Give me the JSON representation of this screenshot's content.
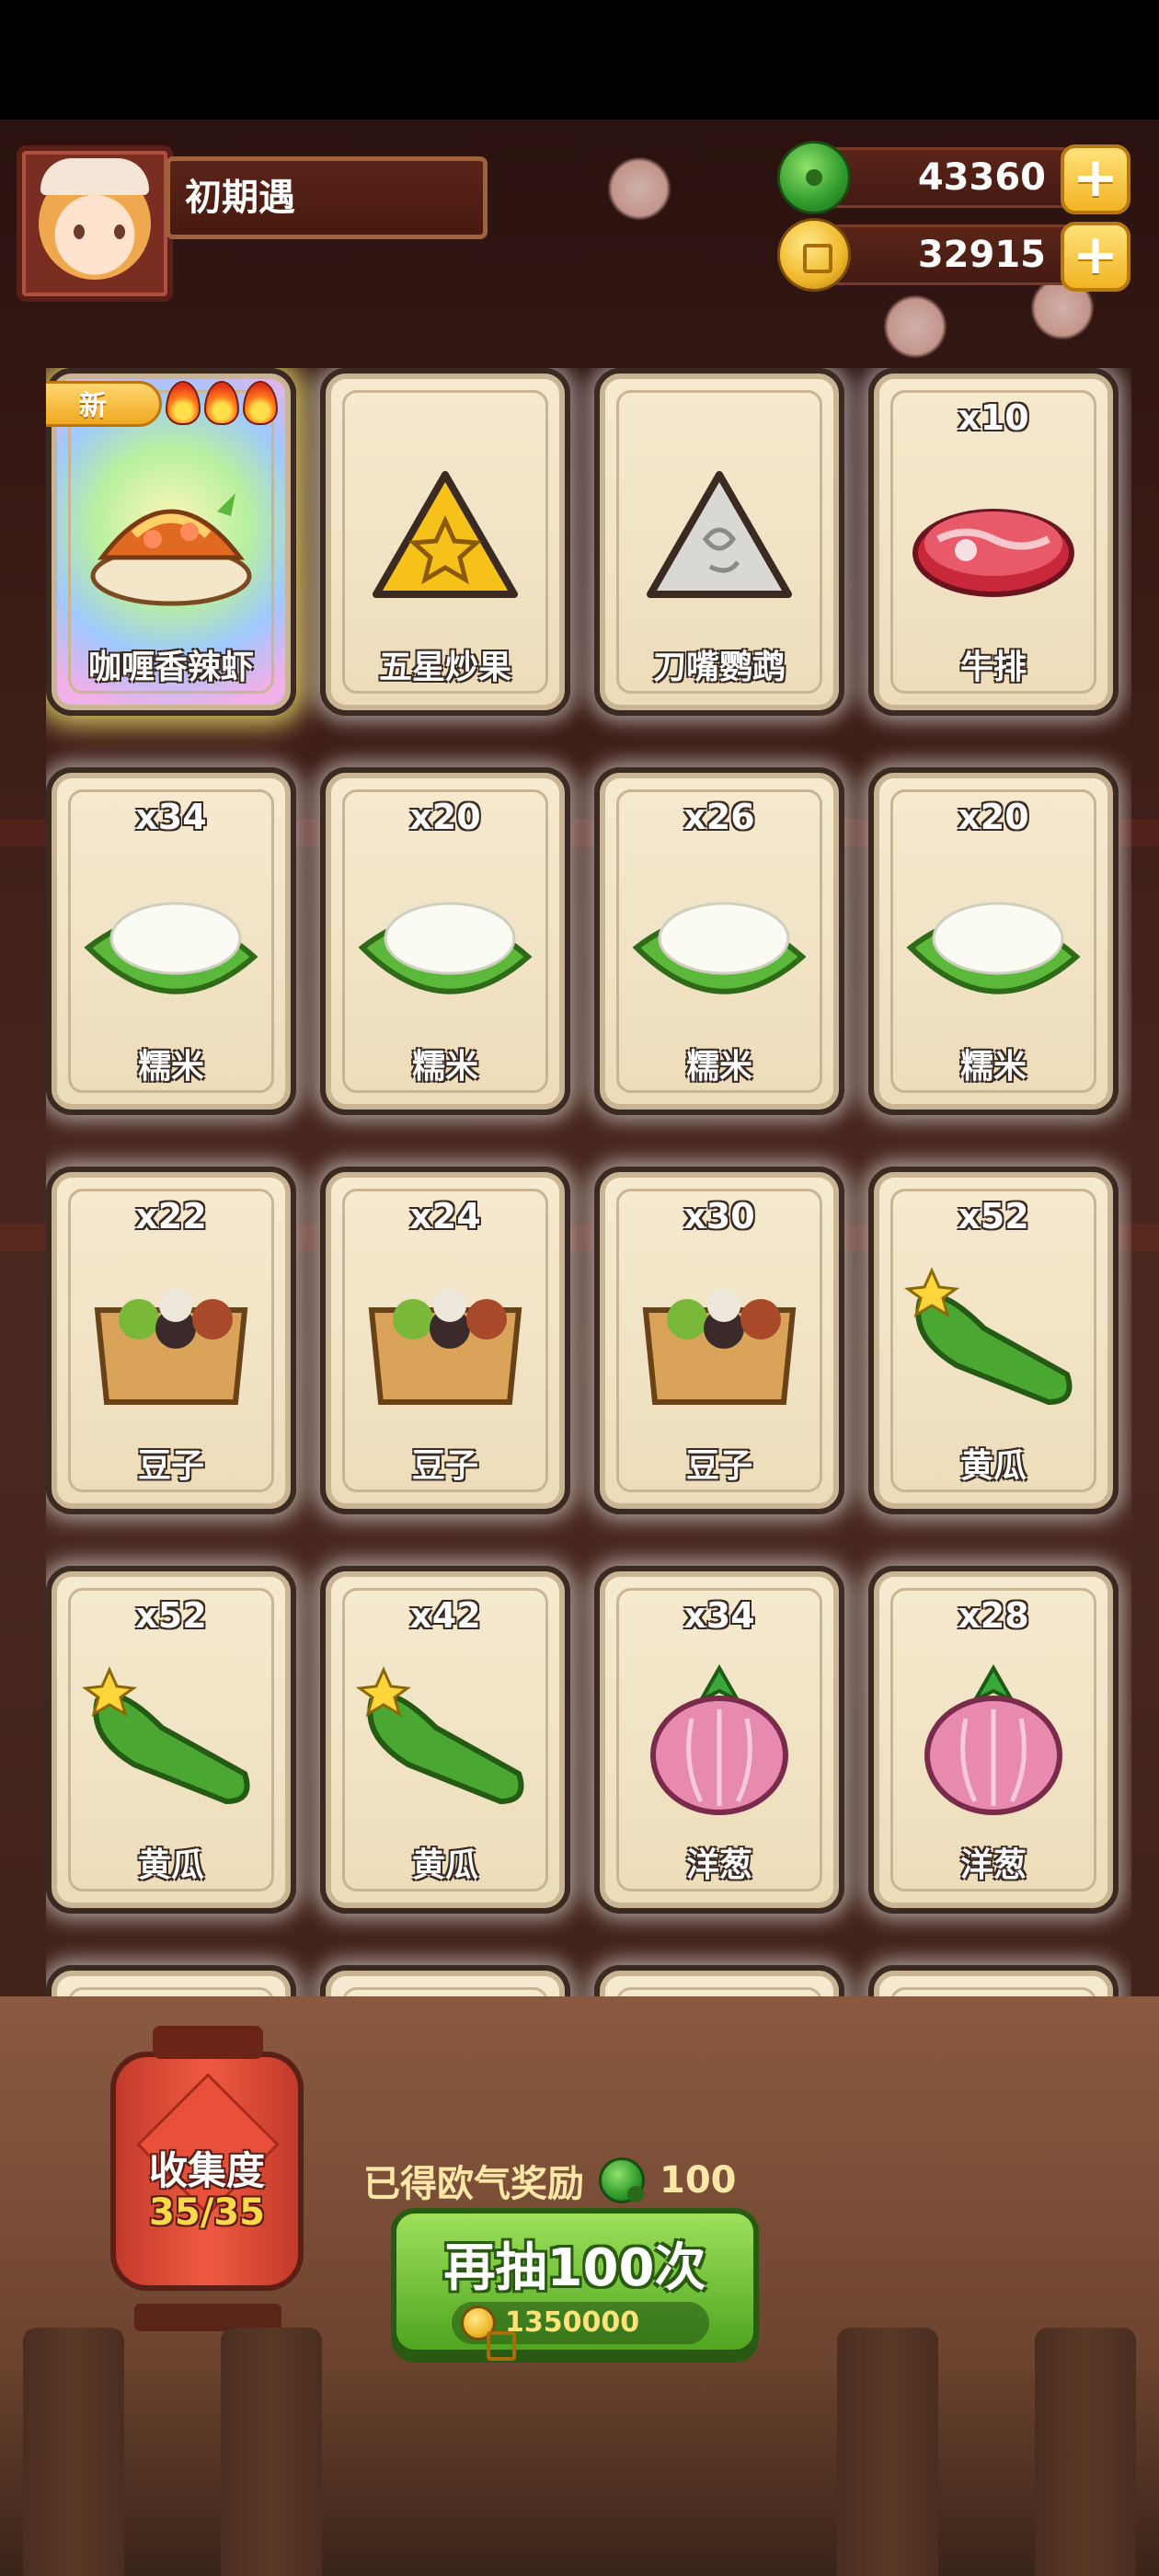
{
  "header": {
    "player_name": "初期遇",
    "currencies": [
      {
        "type": "jade",
        "icon": "jade-icon",
        "value": "43360"
      },
      {
        "type": "coin",
        "icon": "coin-icon",
        "value": "32915"
      }
    ],
    "plus_label": "+"
  },
  "cards": [
    {
      "label": "咖喱香辣虾",
      "qty": "",
      "icon": "curry-shrimp-icon",
      "new_badge": "新",
      "flames": 3
    },
    {
      "label": "五星炒果",
      "qty": "",
      "icon": "star-fruit-icon"
    },
    {
      "label": "刀嘴鹦鹉",
      "qty": "",
      "icon": "parrot-stone-icon"
    },
    {
      "label": "牛排",
      "qty": "x10",
      "icon": "steak-icon"
    },
    {
      "label": "糯米",
      "qty": "x34",
      "icon": "rice-icon"
    },
    {
      "label": "糯米",
      "qty": "x20",
      "icon": "rice-icon"
    },
    {
      "label": "糯米",
      "qty": "x26",
      "icon": "rice-icon"
    },
    {
      "label": "糯米",
      "qty": "x20",
      "icon": "rice-icon"
    },
    {
      "label": "豆子",
      "qty": "x22",
      "icon": "beans-icon"
    },
    {
      "label": "豆子",
      "qty": "x24",
      "icon": "beans-icon"
    },
    {
      "label": "豆子",
      "qty": "x30",
      "icon": "beans-icon"
    },
    {
      "label": "黄瓜",
      "qty": "x52",
      "icon": "cucumber-icon"
    },
    {
      "label": "黄瓜",
      "qty": "x52",
      "icon": "cucumber-icon"
    },
    {
      "label": "黄瓜",
      "qty": "x42",
      "icon": "cucumber-icon"
    },
    {
      "label": "洋葱",
      "qty": "x34",
      "icon": "onion-icon"
    },
    {
      "label": "洋葱",
      "qty": "x28",
      "icon": "onion-icon"
    }
  ],
  "footer": {
    "collection_title": "收集度",
    "collection_count": "35/35",
    "reward_label": "已得欧气奖励",
    "reward_value": "100",
    "draw_button_label": "再抽100次",
    "draw_cost": "1350000"
  }
}
